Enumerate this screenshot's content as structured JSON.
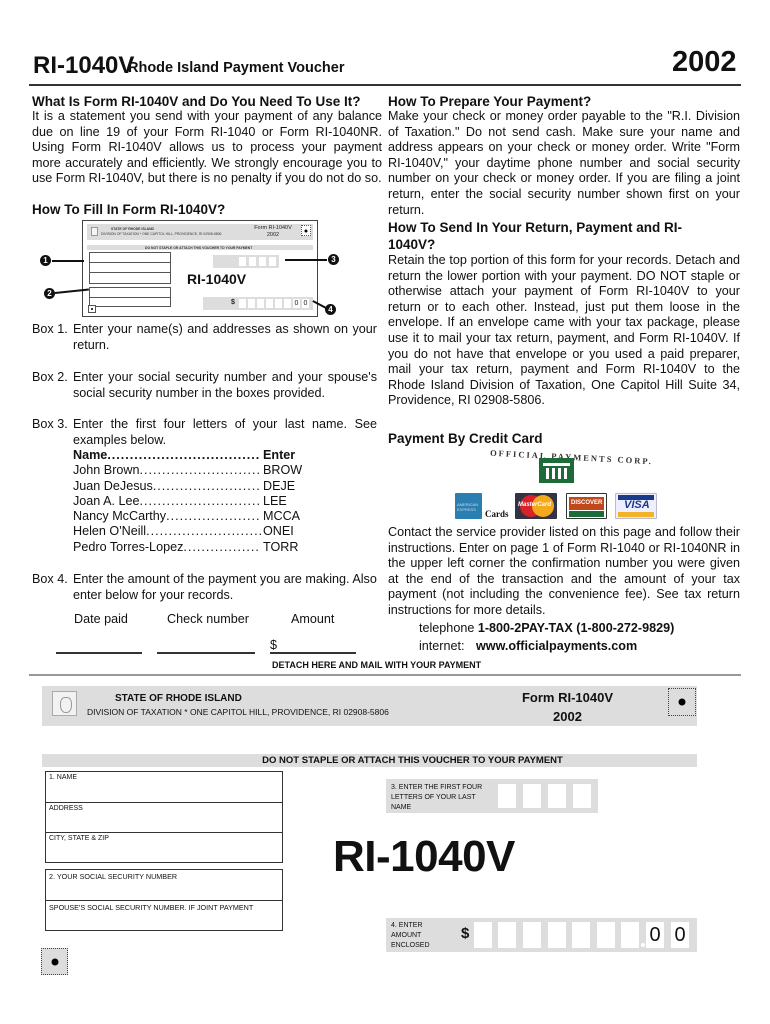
{
  "header": {
    "form_code": "RI-1040V",
    "title": "Rhode Island Payment Voucher",
    "year": "2002"
  },
  "what_is": {
    "heading": "What Is Form RI-1040V and Do You Need To Use It?",
    "body": "It is a statement you send with your payment of any balance due on line 19 of your Form RI-1040 or Form RI-1040NR. Using Form RI-1040V allows us to process your payment more accurately and efficiently.  We strongly encourage you to use Form RI-1040V, but there is no penalty if you do not do so."
  },
  "how_fill": {
    "heading": "How To Fill In Form RI-1040V?",
    "diagram": {
      "state": "STATE OF RHODE ISLAND",
      "division": "DIVISION OF TAXATION * ONE CAPITOL HILL, PROVIDENCE, RI 02908-5806",
      "form": "Form RI-1040V",
      "year": "2002",
      "staple": "DO NOT STAPLE OR ATTACH THIS VOUCHER TO YOUR PAYMENT",
      "big": "RI-1040V",
      "dollar": "$",
      "cents": [
        "0",
        "0"
      ],
      "callouts": [
        "1",
        "2",
        "3",
        "4"
      ]
    },
    "boxes": [
      {
        "label": "Box 1.",
        "text": "Enter your name(s) and addresses as shown on your return."
      },
      {
        "label": "Box 2.",
        "text": "Enter your social security number and your spouse's social security number in the boxes provided."
      },
      {
        "label": "Box 3.",
        "text": "Enter the first four letters of your last name. See examples below."
      },
      {
        "label": "Box 4.",
        "text": "Enter the amount of the payment you are making. Also enter below for your records."
      }
    ],
    "name_table": {
      "header": {
        "name": "Name",
        "code": "Enter"
      },
      "rows": [
        {
          "name": "John Brown",
          "code": "BROW"
        },
        {
          "name": "Juan DeJesus",
          "code": "DEJE"
        },
        {
          "name": "Joan A. Lee",
          "code": "LEE"
        },
        {
          "name": "Nancy McCarthy",
          "code": "MCCA"
        },
        {
          "name": "Helen O'Neill",
          "code": "ONEI"
        },
        {
          "name": "Pedro Torres-Lopez",
          "code": "TORR"
        }
      ]
    },
    "records": {
      "date_label": "Date paid",
      "check_label": "Check number",
      "amount_label": "Amount",
      "dollar": "$",
      "date_value": "",
      "check_value": "",
      "amount_value": ""
    }
  },
  "prepare": {
    "heading": "How To Prepare Your Payment?",
    "body": "Make your check or money order payable to the \"R.I. Division of Taxation.\"  Do not send cash.  Make sure your name and address appears on your check  or money order.  Write \"Form RI-1040V,\" your daytime phone number and social security number on your check or money order.  If you are filing a joint return, enter the social security number shown first on your return."
  },
  "send": {
    "heading": "How To Send In Your Return, Payment and RI-1040V?",
    "body": "Retain the top portion of this form for your records.  Detach and return the lower portion with your payment.   DO NOT staple or otherwise attach your payment of Form RI-1040V to your return or to each other.  Instead, just put them loose in the envelope.  If an envelope came with your tax package, please use it to mail your tax return, payment, and Form RI-1040V.  If you do not have that envelope or you used a paid preparer, mail your tax return, payment and Form RI-1040V to the Rhode Island Division of Taxation, One Capitol Hill Suite 34, Providence, RI  02908-5806."
  },
  "credit": {
    "heading": "Payment By Credit Card",
    "provider_logo_text": "OFFICIAL PAYMENTS CORP.",
    "cards_word": "Cards",
    "card_logos": [
      "american-express",
      "mastercard",
      "discover",
      "visa"
    ],
    "mc_text": "MasterCard",
    "discover_text": "DISCOVER",
    "visa_text": "VISA",
    "amex_text": "AMERICAN EXPRESS",
    "body": "Contact the service provider listed on this page and follow their instructions. Enter on page 1 of Form RI-1040 or RI-1040NR in the upper left corner the confirmation number you were given at the end of the transaction and the amount of your tax payment (not including the convenience fee). See tax return instructions for more details.",
    "telephone_label": "telephone",
    "telephone_value": "1-800-2PAY-TAX (1-800-272-9829)",
    "internet_label": "internet:",
    "internet_value": "www.officialpayments.com"
  },
  "detach": "DETACH HERE AND MAIL WITH YOUR PAYMENT",
  "voucher": {
    "state": "STATE OF RHODE ISLAND",
    "division": "DIVISION OF TAXATION * ONE CAPITOL HILL, PROVIDENCE, RI  02908-5806",
    "form": "Form RI-1040V",
    "year": "2002",
    "staple_notice": "DO NOT STAPLE OR ATTACH THIS VOUCHER TO YOUR PAYMENT",
    "name_fields": [
      "1. NAME",
      "ADDRESS",
      "CITY, STATE & ZIP"
    ],
    "ssn_fields": [
      "2. YOUR SOCIAL SECURITY NUMBER",
      "SPOUSE'S SOCIAL SECURITY NUMBER. IF JOINT PAYMENT"
    ],
    "letters_label": "3. ENTER THE FIRST FOUR LETTERS OF YOUR LAST NAME",
    "big_title": "RI-1040V",
    "amount_label_lines": [
      "4. ENTER",
      "AMOUNT",
      "ENCLOSED"
    ],
    "dollar": "$",
    "cents": [
      "0",
      "0"
    ]
  }
}
